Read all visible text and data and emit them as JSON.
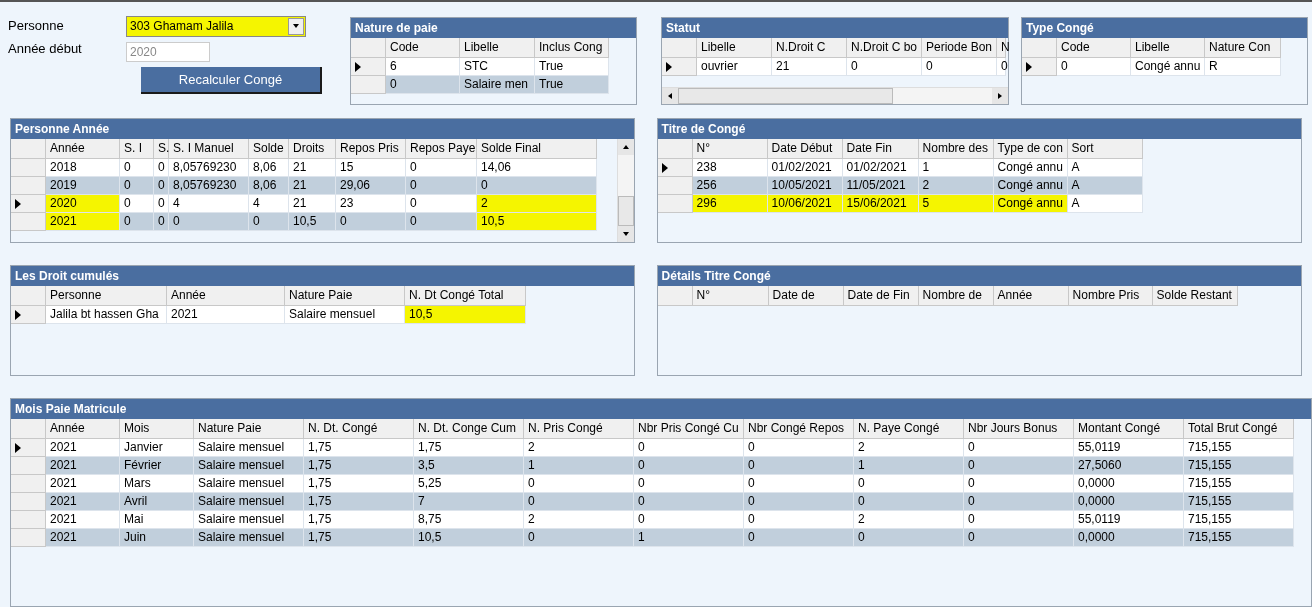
{
  "form": {
    "person_label": "Personne",
    "person_value": "303 Ghamam Jalila",
    "person_highlighted": true,
    "year_label": "Année début",
    "year_value": "2020",
    "recalc_button": "Recalculer Congé"
  },
  "nature_de_paie": {
    "title": "Nature de paie",
    "columns": [
      "Code",
      "Libelle",
      "Inclus Cong"
    ],
    "rows": [
      {
        "selected": true,
        "cells": [
          "6",
          "STC",
          "True"
        ]
      },
      {
        "selected": false,
        "cells": [
          "0",
          "Salaire men",
          "True"
        ]
      }
    ]
  },
  "statut": {
    "title": "Statut",
    "columns": [
      "Libelle",
      "N.Droit C",
      "N.Droit C bo",
      "Periode Bon",
      "N"
    ],
    "rows": [
      {
        "selected": true,
        "cells": [
          "ouvrier",
          "21",
          "0",
          "0",
          "0"
        ]
      }
    ]
  },
  "type_conge": {
    "title": "Type Congé",
    "columns": [
      "Code",
      "Libelle",
      "Nature Con"
    ],
    "rows": [
      {
        "selected": true,
        "cells": [
          "0",
          "Congé annu",
          "R"
        ]
      }
    ]
  },
  "personne_annee": {
    "title": "Personne Année",
    "columns": [
      "Année",
      "S. I",
      "S.",
      "S. I Manuel",
      "Solde",
      "Droits",
      "Repos Pris",
      "Repos Paye",
      "Solde Final"
    ],
    "rows": [
      {
        "selected": false,
        "cells": [
          "2018",
          "0",
          "0",
          "8,05769230",
          "8,06",
          "21",
          "15",
          "0",
          "14,06"
        ]
      },
      {
        "selected": false,
        "cells": [
          "2019",
          "0",
          "0",
          "8,05769230",
          "8,06",
          "21",
          "29,06",
          "0",
          "0"
        ]
      },
      {
        "selected": true,
        "cells": [
          {
            "text": "2020",
            "highlighted": true
          },
          "0",
          "0",
          "4",
          "4",
          "21",
          "23",
          "0",
          {
            "text": "2",
            "highlighted": true
          }
        ]
      },
      {
        "selected": false,
        "cells": [
          {
            "text": "2021",
            "highlighted": true
          },
          "0",
          "0",
          "0",
          "0",
          "10,5",
          "0",
          "0",
          {
            "text": "10,5",
            "highlighted": true
          }
        ]
      }
    ]
  },
  "titre_de_conge": {
    "title": "Titre de Congé",
    "columns": [
      "N°",
      "Date Début",
      "Date Fin",
      "Nombre des",
      "Type de con",
      "Sort"
    ],
    "rows": [
      {
        "selected": true,
        "cells": [
          "238",
          "01/02/2021",
          "01/02/2021",
          "1",
          "Congé annu",
          "A"
        ]
      },
      {
        "selected": false,
        "cells": [
          "256",
          "10/05/2021",
          "11/05/2021",
          "2",
          "Congé annu",
          "A"
        ]
      },
      {
        "selected": false,
        "cells": [
          {
            "text": "296",
            "highlighted": true
          },
          {
            "text": "10/06/2021",
            "highlighted": true
          },
          {
            "text": "15/06/2021",
            "highlighted": true
          },
          {
            "text": "5",
            "highlighted": true
          },
          {
            "text": "Congé annu",
            "highlighted": true
          },
          "A"
        ]
      }
    ]
  },
  "droits_cumules": {
    "title": "Les Droit cumulés",
    "columns": [
      "Personne",
      "Année",
      "Nature Paie",
      "N. Dt Congé Total"
    ],
    "rows": [
      {
        "selected": true,
        "cells": [
          "Jalila bt hassen Gha",
          "2021",
          "Salaire mensuel",
          {
            "text": "10,5",
            "highlighted": true
          }
        ]
      }
    ]
  },
  "details_titre_conge": {
    "title": "Détails Titre Congé",
    "columns": [
      "N°",
      "Date de",
      "Date de Fin",
      "Nombre de",
      "Année",
      "Nombre Pris",
      "Solde Restant"
    ]
  },
  "mois_paie_matricule": {
    "title": "Mois Paie Matricule",
    "columns": [
      "Année",
      "Mois",
      "Nature Paie",
      "N. Dt. Congé",
      "N. Dt. Conge Cum",
      "N. Pris Congé",
      "Nbr Pris Congé Cu",
      "Nbr Congé Repos",
      "N. Paye Congé",
      "Nbr Jours Bonus",
      "Montant Congé",
      "Total Brut Congé"
    ],
    "rows": [
      {
        "selected": true,
        "cells": [
          "2021",
          "Janvier",
          "Salaire mensuel",
          "1,75",
          "1,75",
          "2",
          "0",
          "0",
          "2",
          "0",
          "55,0119",
          "715,155"
        ]
      },
      {
        "selected": false,
        "cells": [
          "2021",
          "Février",
          "Salaire mensuel",
          "1,75",
          "3,5",
          "1",
          "0",
          "0",
          "1",
          "0",
          "27,5060",
          "715,155"
        ]
      },
      {
        "selected": false,
        "cells": [
          "2021",
          "Mars",
          "Salaire mensuel",
          "1,75",
          "5,25",
          "0",
          "0",
          "0",
          "0",
          "0",
          "0,0000",
          "715,155"
        ]
      },
      {
        "selected": false,
        "cells": [
          "2021",
          "Avril",
          "Salaire mensuel",
          "1,75",
          "7",
          "0",
          "0",
          "0",
          "0",
          "0",
          "0,0000",
          "715,155"
        ]
      },
      {
        "selected": false,
        "cells": [
          "2021",
          "Mai",
          "Salaire mensuel",
          "1,75",
          "8,75",
          "2",
          "0",
          "0",
          "2",
          "0",
          "55,0119",
          "715,155"
        ]
      },
      {
        "selected": false,
        "cells": [
          "2021",
          "Juin",
          "Salaire mensuel",
          "1,75",
          "10,5",
          "0",
          "1",
          "0",
          "0",
          "0",
          "0,0000",
          "715,155"
        ]
      }
    ]
  }
}
